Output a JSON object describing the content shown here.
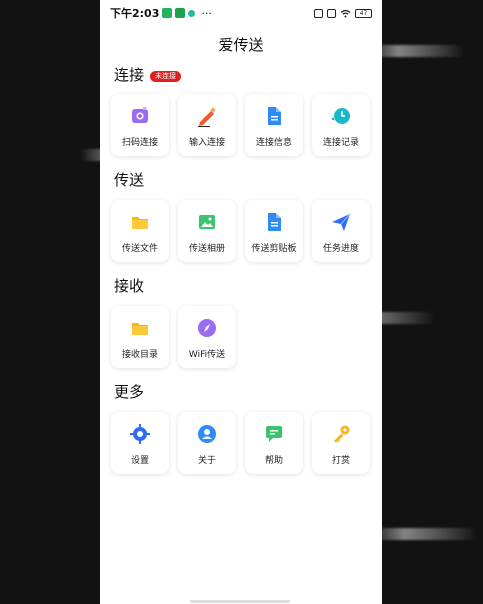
{
  "status_bar": {
    "time": "下午2:03",
    "more": "···",
    "battery": "47"
  },
  "app": {
    "title": "爱传送"
  },
  "sections": {
    "connect": {
      "title": "连接",
      "badge": "未连接",
      "items": [
        {
          "label": "扫码连接",
          "icon": "scan-camera-icon"
        },
        {
          "label": "输入连接",
          "icon": "pencil-icon"
        },
        {
          "label": "连接信息",
          "icon": "document-icon"
        },
        {
          "label": "连接记录",
          "icon": "clock-icon"
        }
      ]
    },
    "send": {
      "title": "传送",
      "items": [
        {
          "label": "传送文件",
          "icon": "folder-icon"
        },
        {
          "label": "传送相册",
          "icon": "photo-icon"
        },
        {
          "label": "传送剪贴板",
          "icon": "clipboard-doc-icon"
        },
        {
          "label": "任务进度",
          "icon": "paper-plane-icon"
        }
      ]
    },
    "receive": {
      "title": "接收",
      "items": [
        {
          "label": "接收目录",
          "icon": "folder-icon"
        },
        {
          "label": "WiFi传送",
          "icon": "compass-icon"
        }
      ]
    },
    "more": {
      "title": "更多",
      "items": [
        {
          "label": "设置",
          "icon": "gear-icon"
        },
        {
          "label": "关于",
          "icon": "user-icon"
        },
        {
          "label": "帮助",
          "icon": "chat-icon"
        },
        {
          "label": "打赏",
          "icon": "key-icon"
        }
      ]
    }
  },
  "colors": {
    "purple": "#9b6cf0",
    "orange": "#f05a28",
    "blue": "#2f8cf5",
    "teal": "#19b9c9",
    "yellow": "#f7b51b",
    "green": "#39c46e",
    "red_badge": "#e02020"
  }
}
